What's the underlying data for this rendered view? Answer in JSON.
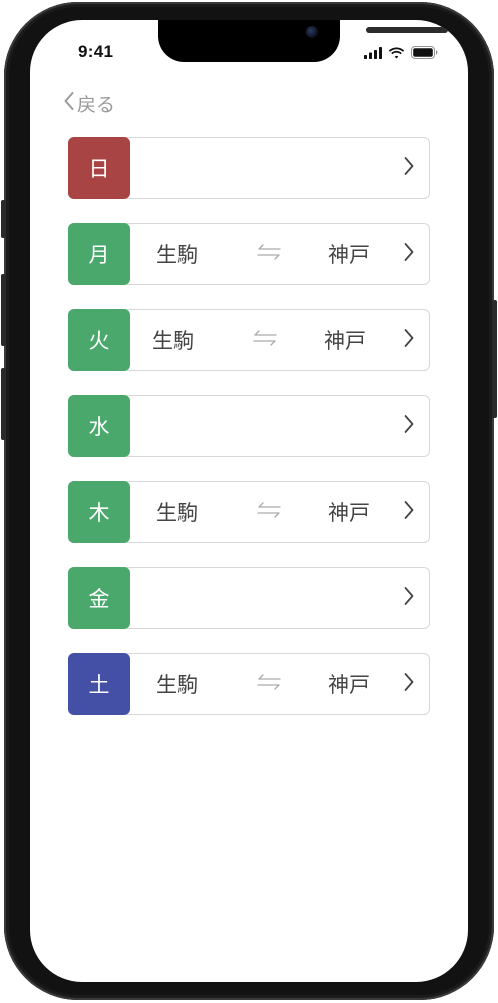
{
  "status_bar": {
    "time": "9:41"
  },
  "nav": {
    "back_label": "戻る"
  },
  "colors": {
    "sunday": "#a94445",
    "weekday": "#4aa86c",
    "saturday": "#4350a6"
  },
  "days": [
    {
      "day": "日",
      "color": "#a94445",
      "from": "",
      "to": ""
    },
    {
      "day": "月",
      "color": "#4aa86c",
      "from": "生駒",
      "to": "神戸"
    },
    {
      "day": "火",
      "color": "#4aa86c",
      "from": "生駒",
      "to": "神戸"
    },
    {
      "day": "水",
      "color": "#4aa86c",
      "from": "",
      "to": ""
    },
    {
      "day": "木",
      "color": "#4aa86c",
      "from": "生駒",
      "to": "神戸"
    },
    {
      "day": "金",
      "color": "#4aa86c",
      "from": "",
      "to": ""
    },
    {
      "day": "土",
      "color": "#4350a6",
      "from": "生駒",
      "to": "神戸"
    }
  ]
}
